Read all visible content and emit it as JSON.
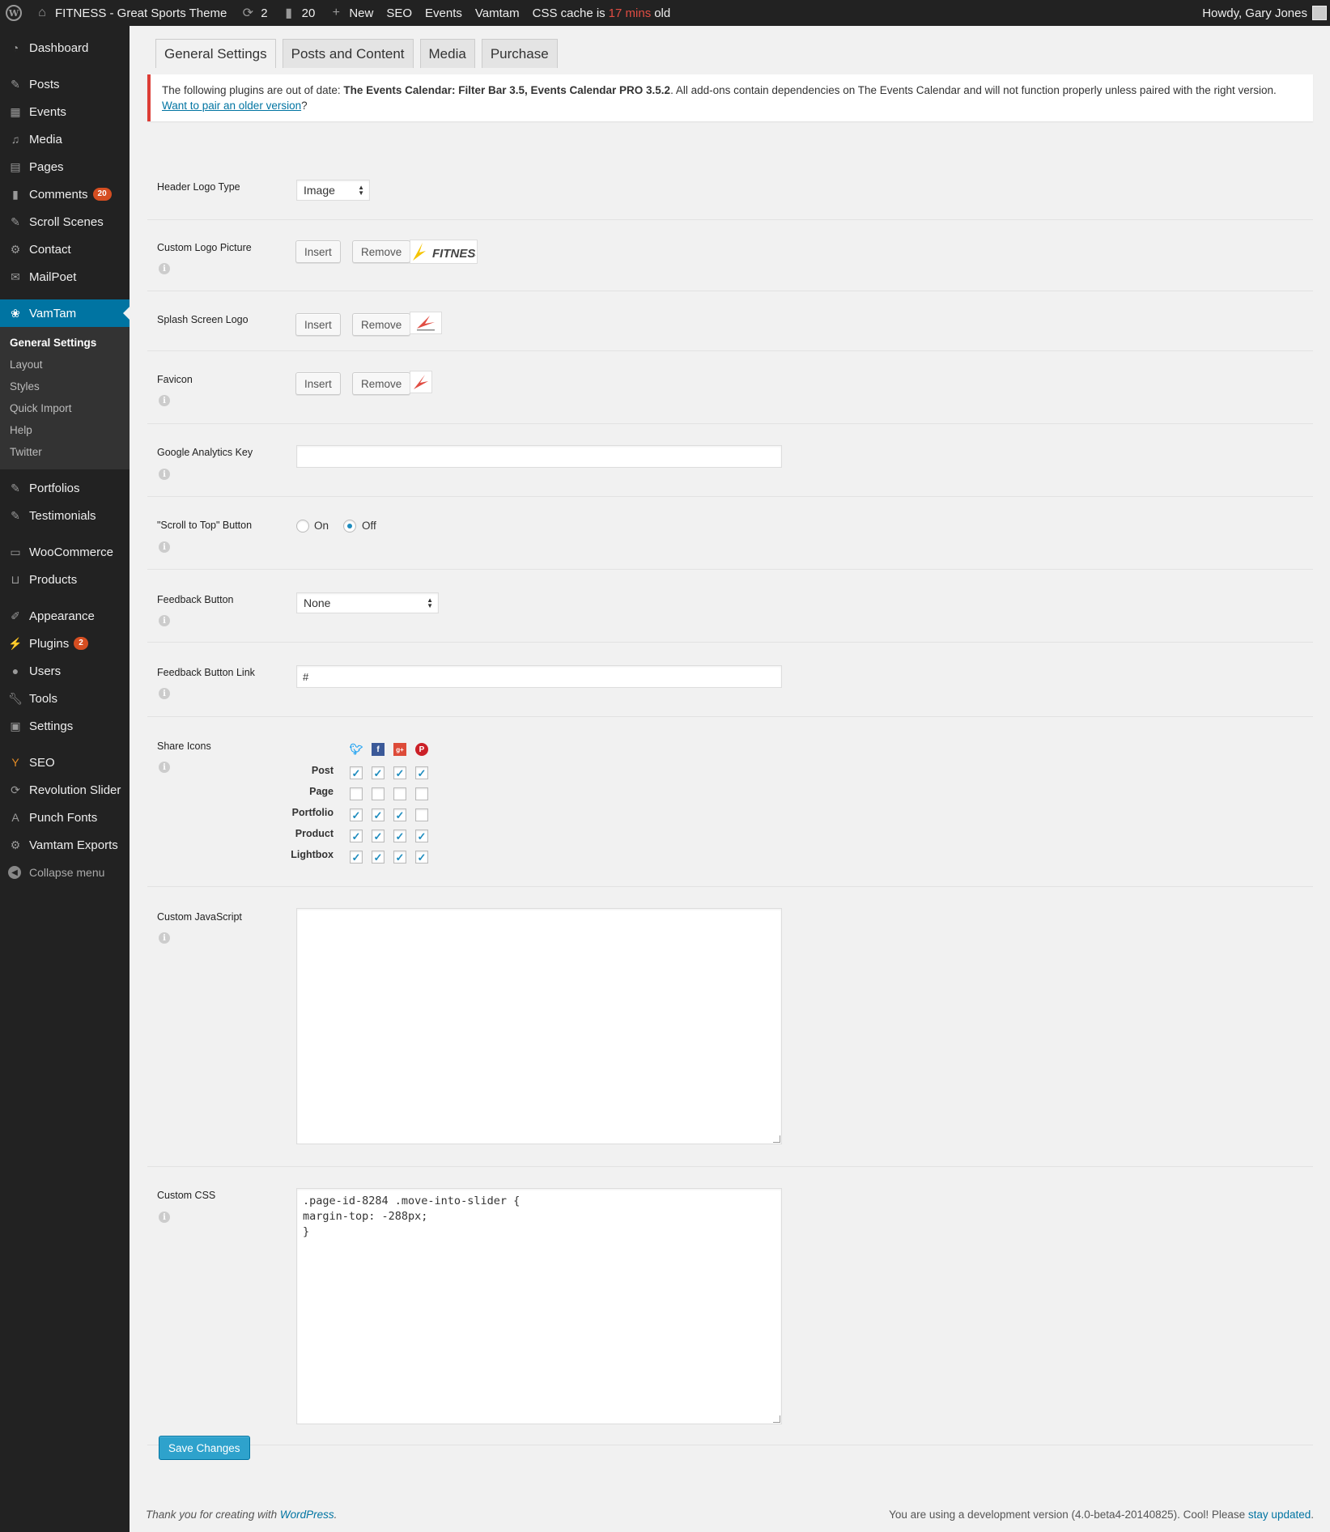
{
  "adminbar": {
    "site_name": "FITNESS - Great Sports Theme",
    "updates_count": "2",
    "comments_count": "20",
    "new_label": "New",
    "seo_label": "SEO",
    "events_label": "Events",
    "vamtam_label": "Vamtam",
    "cache_prefix": "CSS cache is",
    "cache_mins": "17 mins",
    "cache_suffix": "old",
    "howdy": "Howdy, Gary Jones"
  },
  "sidebar": {
    "items": [
      {
        "label": "Dashboard",
        "icon": "dashboard-icon"
      },
      {
        "label": "Posts",
        "icon": "pin-icon"
      },
      {
        "label": "Events",
        "icon": "calendar-icon"
      },
      {
        "label": "Media",
        "icon": "media-icon"
      },
      {
        "label": "Pages",
        "icon": "pages-icon"
      },
      {
        "label": "Comments",
        "icon": "comment-icon",
        "count": "20"
      },
      {
        "label": "Scroll Scenes",
        "icon": "pin-icon"
      },
      {
        "label": "Contact",
        "icon": "gear-icon"
      },
      {
        "label": "MailPoet",
        "icon": "mail-icon"
      },
      {
        "label": "VamTam",
        "icon": "vamtam-icon"
      },
      {
        "label": "Portfolios",
        "icon": "pin-icon"
      },
      {
        "label": "Testimonials",
        "icon": "pin-icon"
      },
      {
        "label": "WooCommerce",
        "icon": "woo-icon"
      },
      {
        "label": "Products",
        "icon": "cart-icon"
      },
      {
        "label": "Appearance",
        "icon": "brush-icon"
      },
      {
        "label": "Plugins",
        "icon": "plugin-icon",
        "count": "2"
      },
      {
        "label": "Users",
        "icon": "user-icon"
      },
      {
        "label": "Tools",
        "icon": "wrench-icon"
      },
      {
        "label": "Settings",
        "icon": "settings-icon"
      },
      {
        "label": "SEO",
        "icon": "seo-icon"
      },
      {
        "label": "Revolution Slider",
        "icon": "refresh-icon"
      },
      {
        "label": "Punch Fonts",
        "icon": "font-icon"
      },
      {
        "label": "Vamtam Exports",
        "icon": "gear-icon"
      }
    ],
    "submenu": [
      "General Settings",
      "Layout",
      "Styles",
      "Quick Import",
      "Help",
      "Twitter"
    ],
    "collapse_label": "Collapse menu"
  },
  "tabs": [
    "General Settings",
    "Posts and Content",
    "Media",
    "Purchase"
  ],
  "notice": {
    "intro": "The following plugins are out of date:",
    "plugins": "The Events Calendar: Filter Bar 3.5, Events Calendar PRO 3.5.2",
    "rest": ". All add-ons contain dependencies on The Events Calendar and will not function properly unless paired with the right version.",
    "link": "Want to pair an older version",
    "end": "?"
  },
  "fields": {
    "header_logo_type": {
      "label": "Header Logo Type",
      "value": "Image"
    },
    "custom_logo": {
      "label": "Custom Logo Picture",
      "logo_text": "FITNESS"
    },
    "splash_logo": {
      "label": "Splash Screen Logo"
    },
    "favicon": {
      "label": "Favicon"
    },
    "insert_label": "Insert",
    "remove_label": "Remove",
    "analytics": {
      "label": "Google Analytics Key",
      "value": ""
    },
    "scroll_top": {
      "label": "\"Scroll to Top\" Button",
      "on": "On",
      "off": "Off",
      "selected": "off"
    },
    "feedback": {
      "label": "Feedback Button",
      "value": "None"
    },
    "feedback_link": {
      "label": "Feedback Button Link",
      "value": "#"
    },
    "share": {
      "label": "Share Icons",
      "networks": [
        "twitter",
        "facebook",
        "googleplus",
        "pinterest"
      ],
      "rows": [
        {
          "name": "Post",
          "checked": [
            true,
            true,
            true,
            true
          ]
        },
        {
          "name": "Page",
          "checked": [
            false,
            false,
            false,
            false
          ]
        },
        {
          "name": "Portfolio",
          "checked": [
            true,
            true,
            true,
            false
          ]
        },
        {
          "name": "Product",
          "checked": [
            true,
            true,
            true,
            true
          ]
        },
        {
          "name": "Lightbox",
          "checked": [
            true,
            true,
            true,
            true
          ]
        }
      ]
    },
    "custom_js": {
      "label": "Custom JavaScript",
      "value": ""
    },
    "custom_css": {
      "label": "Custom CSS",
      "value": ".page-id-8284 .move-into-slider {\nmargin-top: -288px;\n}"
    }
  },
  "save_label": "Save Changes",
  "footer": {
    "left_text": "Thank you for creating with",
    "left_link": "WordPress",
    "right_text": "You are using a development version (4.0-beta4-20140825). Cool! Please",
    "right_link": "stay updated"
  }
}
